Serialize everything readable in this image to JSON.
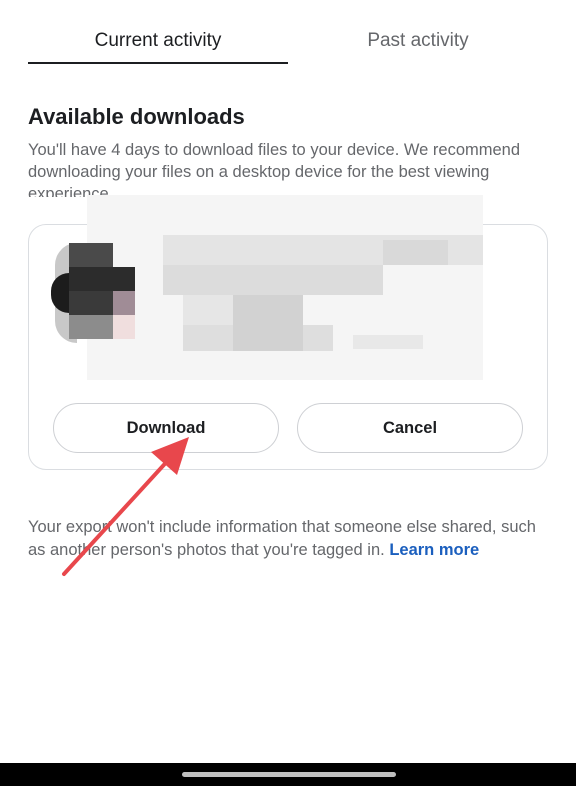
{
  "tabs": {
    "current": "Current activity",
    "past": "Past activity"
  },
  "section": {
    "title": "Available downloads",
    "description": "You'll have 4 days to download files to your device. We recommend downloading your files on a desktop device for the best viewing experience."
  },
  "card": {
    "download_label": "Download",
    "cancel_label": "Cancel"
  },
  "footer": {
    "note": "Your export won't include information that someone else shared, such as another person's photos that you're tagged in.",
    "learn_more": "Learn more"
  },
  "colors": {
    "link": "#1b5fbe",
    "annotation_arrow": "#e8474c"
  },
  "icons": {
    "annotation": "red-arrow-icon"
  }
}
